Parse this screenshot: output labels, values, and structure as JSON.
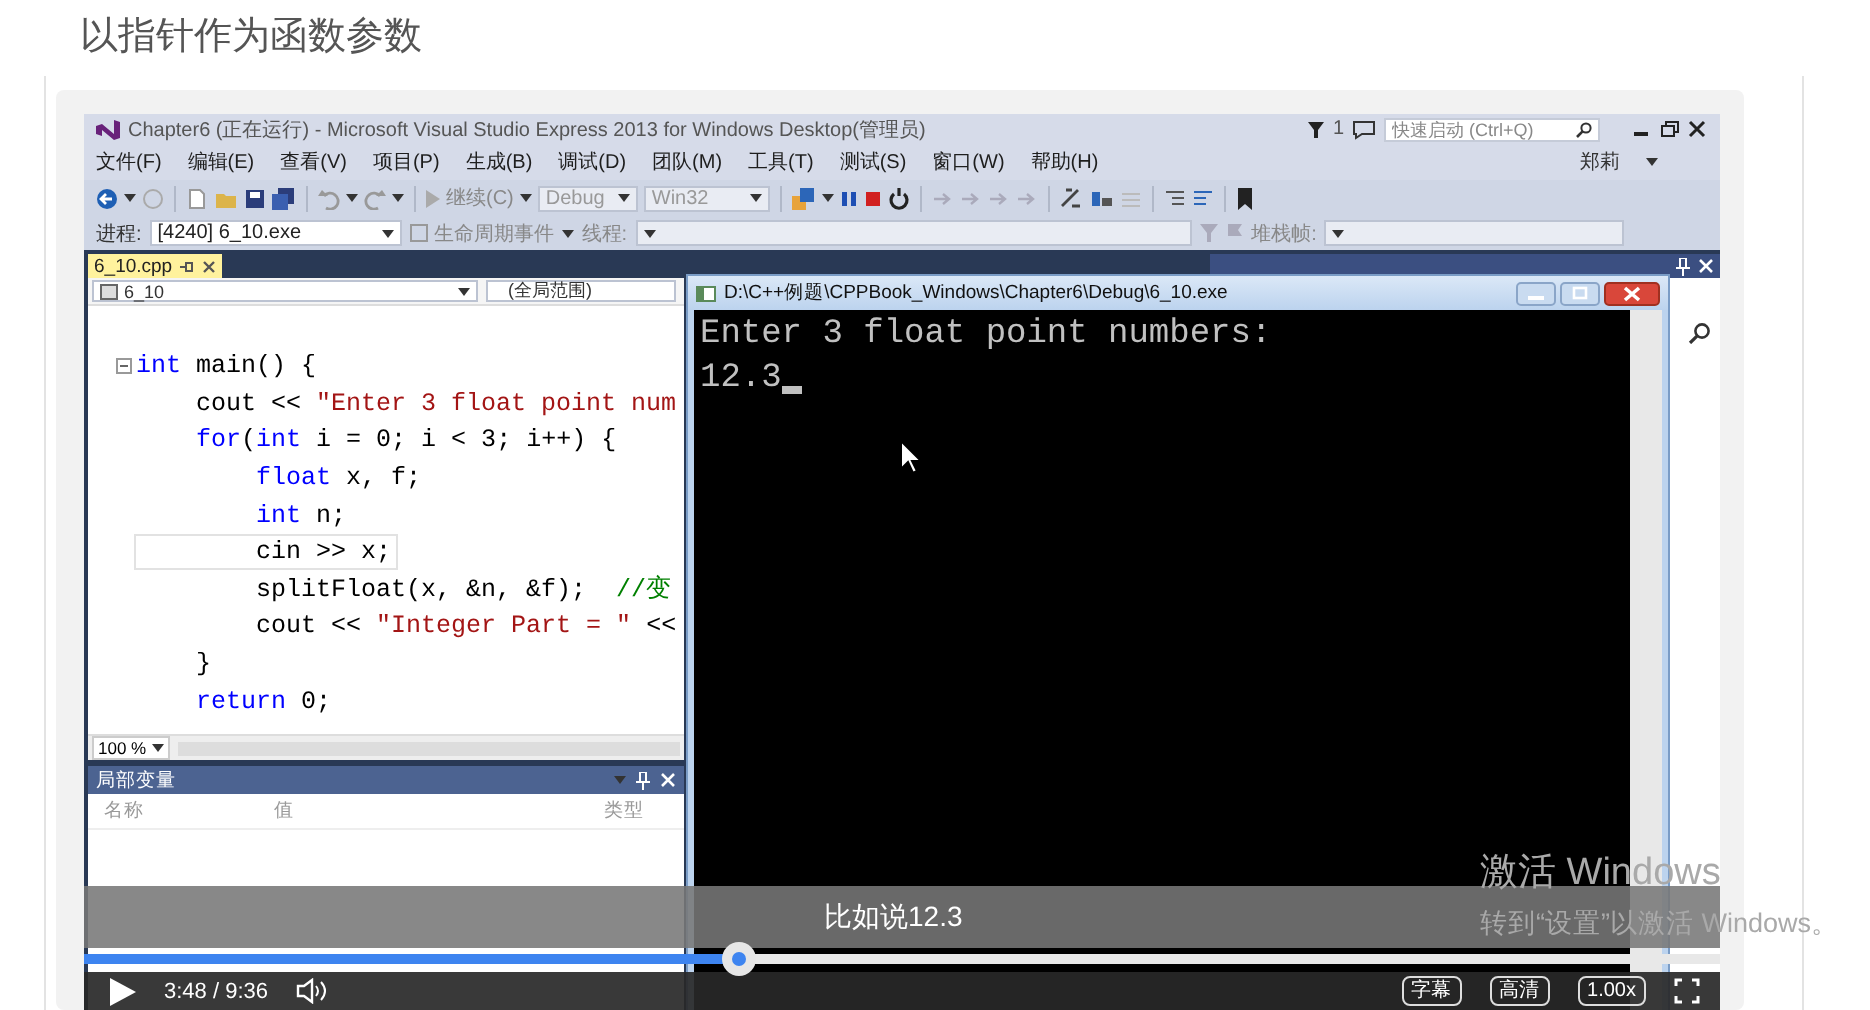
{
  "page": {
    "heading": "以指针作为函数参数"
  },
  "vs": {
    "title": "Chapter6 (正在运行) - Microsoft Visual Studio Express 2013 for Windows Desktop(管理员)",
    "notifications": "1",
    "quick_launch": {
      "placeholder": "快速启动 (Ctrl+Q)"
    },
    "user": "郑莉",
    "menu": [
      "文件(F)",
      "编辑(E)",
      "查看(V)",
      "项目(P)",
      "生成(B)",
      "调试(D)",
      "团队(M)",
      "工具(T)",
      "测试(S)",
      "窗口(W)",
      "帮助(H)"
    ],
    "toolbar": {
      "continue": "继续(C)",
      "configuration": "Debug",
      "platform": "Win32"
    },
    "debug_bar": {
      "process_label": "进程:",
      "process": "[4240] 6_10.exe",
      "lifecycle": "生命周期事件",
      "thread_label": "线程:",
      "stack_label": "堆栈帧:"
    },
    "editor": {
      "tabs": [
        {
          "label": "6_10.cpp",
          "selected": true
        }
      ],
      "scope": "6_10",
      "member": "(全局范围)",
      "zoom": "100 %",
      "lines": [
        {
          "fold": true,
          "current": false,
          "tokens": [
            {
              "kind": "kw",
              "text": "int"
            },
            {
              "kind": "txt",
              "text": " main() {"
            }
          ]
        },
        {
          "fold": false,
          "current": false,
          "tokens": [
            {
              "kind": "txt",
              "text": "    cout << "
            },
            {
              "kind": "str",
              "text": "\"Enter 3 float point num"
            }
          ]
        },
        {
          "fold": false,
          "current": false,
          "tokens": [
            {
              "kind": "kw",
              "text": "    for"
            },
            {
              "kind": "txt",
              "text": "("
            },
            {
              "kind": "kw",
              "text": "int"
            },
            {
              "kind": "txt",
              "text": " i = 0; i < 3; i++) {"
            }
          ]
        },
        {
          "fold": false,
          "current": false,
          "tokens": [
            {
              "kind": "kw",
              "text": "        float"
            },
            {
              "kind": "txt",
              "text": " x, f;"
            }
          ]
        },
        {
          "fold": false,
          "current": false,
          "tokens": [
            {
              "kind": "kw",
              "text": "        int"
            },
            {
              "kind": "txt",
              "text": " n;"
            }
          ]
        },
        {
          "fold": false,
          "current": true,
          "tokens": [
            {
              "kind": "txt",
              "text": "        cin >> x;"
            }
          ]
        },
        {
          "fold": false,
          "current": false,
          "tokens": [
            {
              "kind": "txt",
              "text": "        splitFloat(x, &n, &f);  "
            },
            {
              "kind": "cm",
              "text": "//变"
            }
          ]
        },
        {
          "fold": false,
          "current": false,
          "tokens": [
            {
              "kind": "txt",
              "text": "        cout << "
            },
            {
              "kind": "str",
              "text": "\"Integer Part = \""
            },
            {
              "kind": "txt",
              "text": " <<"
            }
          ]
        },
        {
          "fold": false,
          "current": false,
          "tokens": [
            {
              "kind": "txt",
              "text": "    }"
            }
          ]
        },
        {
          "fold": false,
          "current": false,
          "tokens": [
            {
              "kind": "kw",
              "text": "    return"
            },
            {
              "kind": "txt",
              "text": " 0;"
            }
          ]
        }
      ]
    },
    "locals": {
      "title": "局部变量",
      "columns": [
        "名称",
        "值",
        "类型"
      ]
    }
  },
  "console": {
    "title": "D:\\C++例题\\CPPBook_Windows\\Chapter6\\Debug\\6_10.exe",
    "lines": [
      "Enter 3 float point numbers:",
      "12.3"
    ]
  },
  "player": {
    "subtitle": "比如说12.3",
    "progress": {
      "level": 0.4
    },
    "time": "3:48 / 9:36",
    "buttons": [
      "字幕",
      "高清",
      "1.00x"
    ]
  },
  "activation": {
    "title": "激活 Windows",
    "message": "转到“设置”以激活 Windows。"
  }
}
